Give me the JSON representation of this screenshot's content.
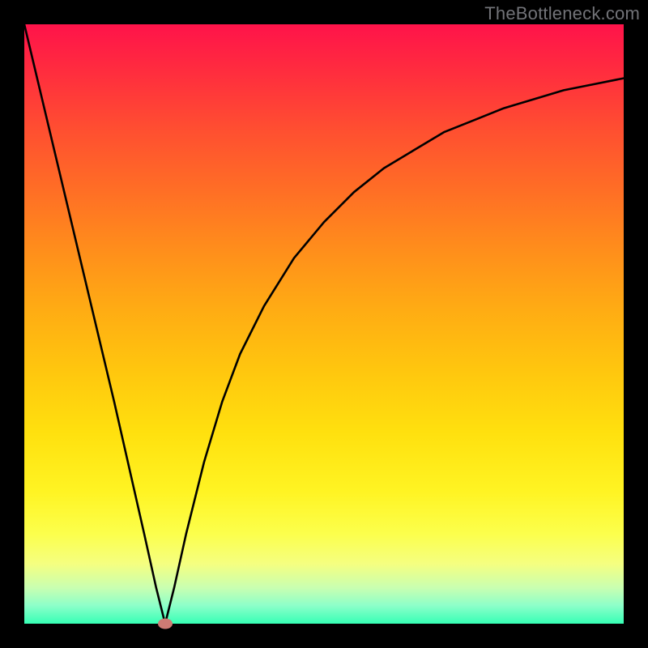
{
  "watermark": "TheBottleneck.com",
  "chart_data": {
    "type": "line",
    "title": "",
    "xlabel": "",
    "ylabel": "",
    "xlim": [
      0,
      100
    ],
    "ylim": [
      0,
      100
    ],
    "series": [
      {
        "name": "curve",
        "x": [
          0,
          5,
          10,
          15,
          20,
          22,
          23.5,
          25,
          27,
          30,
          33,
          36,
          40,
          45,
          50,
          55,
          60,
          65,
          70,
          75,
          80,
          85,
          90,
          95,
          100
        ],
        "y": [
          100,
          79,
          58,
          37,
          15,
          6,
          0,
          6,
          15,
          27,
          37,
          45,
          53,
          61,
          67,
          72,
          76,
          79,
          82,
          84,
          86,
          87.5,
          89,
          90,
          91
        ]
      }
    ],
    "marker": {
      "x": 23.5,
      "y": 0
    },
    "colors": {
      "gradient_top": "#ff134a",
      "gradient_mid": "#ffd80e",
      "gradient_bottom": "#36ffb5",
      "curve": "#000000",
      "marker": "#cf7b74",
      "frame": "#000000"
    }
  }
}
